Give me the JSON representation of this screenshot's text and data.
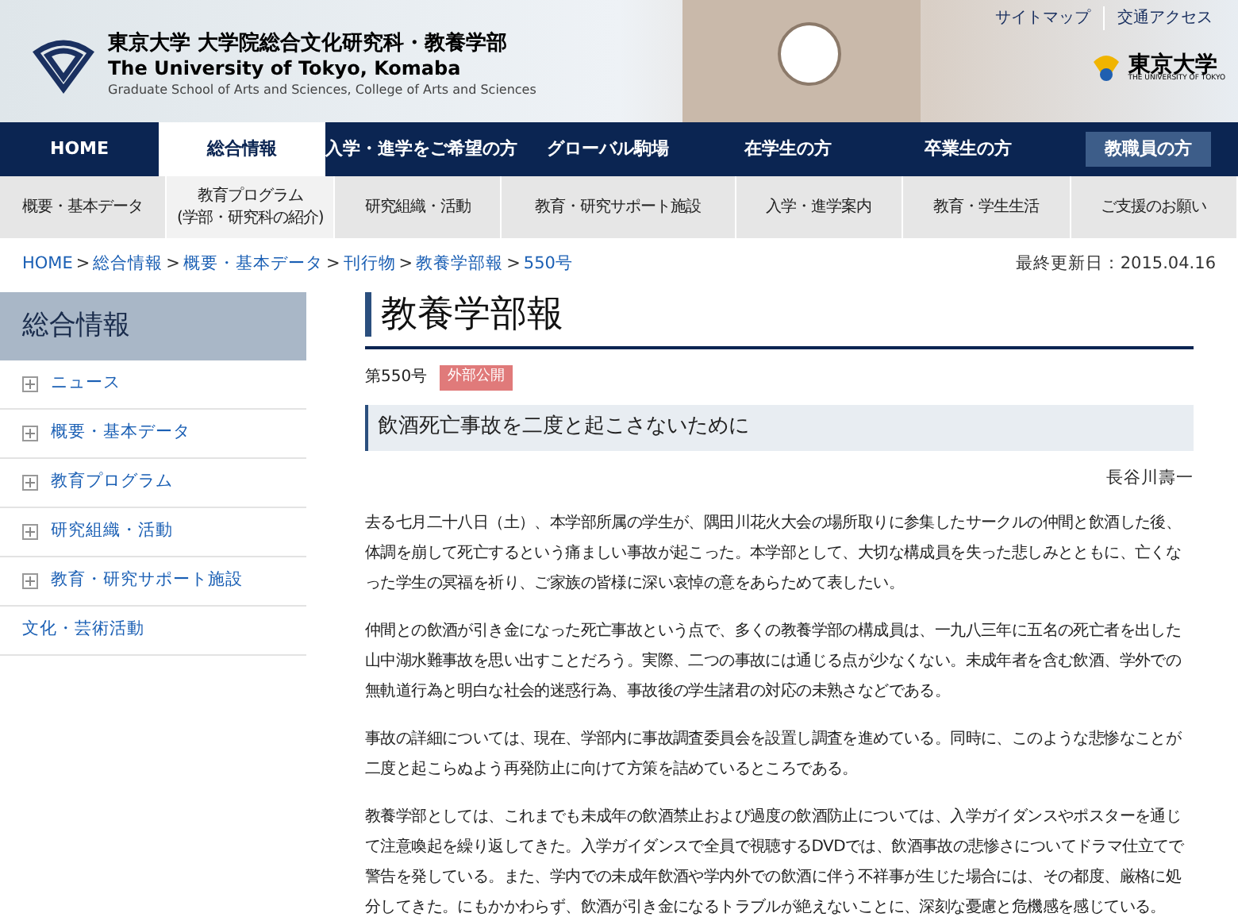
{
  "header": {
    "title_ja": "東京大学 大学院総合文化研究科・教養学部",
    "title_en": "The University of Tokyo, Komaba",
    "subtitle": "Graduate School of Arts and Sciences, College of Arts and Sciences",
    "utility_links": [
      "サイトマップ",
      "交通アクセス"
    ],
    "university_logo": {
      "name": "東京大学",
      "name_en": "THE UNIVERSITY OF TOKYO"
    }
  },
  "main_nav": [
    {
      "label": "HOME",
      "selected": false,
      "boxed": false
    },
    {
      "label": "総合情報",
      "selected": true,
      "boxed": false
    },
    {
      "label": "入学・進学をご希望の方",
      "selected": false,
      "boxed": false
    },
    {
      "label": "グローバル駒場",
      "selected": false,
      "boxed": false
    },
    {
      "label": "在学生の方",
      "selected": false,
      "boxed": false
    },
    {
      "label": "卒業生の方",
      "selected": false,
      "boxed": false
    },
    {
      "label": "教職員の方",
      "selected": false,
      "boxed": true
    }
  ],
  "sub_nav": [
    {
      "label": "概要・基本データ",
      "selected": false
    },
    {
      "label": "教育プログラム\n(学部・研究科の紹介)",
      "selected": true
    },
    {
      "label": "研究組織・活動",
      "selected": false
    },
    {
      "label": "教育・研究サポート施設",
      "selected": false
    },
    {
      "label": "入学・進学案内",
      "selected": false
    },
    {
      "label": "教育・学生生活",
      "selected": false
    },
    {
      "label": "ご支援のお願い",
      "selected": false
    }
  ],
  "breadcrumb_separator": ">",
  "breadcrumb": [
    "HOME",
    "総合情報",
    "概要・基本データ",
    "刊行物",
    "教養学部報",
    "550号"
  ],
  "last_updated": "最終更新日：2015.04.16",
  "sidebar": {
    "title": "総合情報",
    "items": [
      {
        "label": "ニュース",
        "kind": "expandable"
      },
      {
        "label": "概要・基本データ",
        "kind": "expandable"
      },
      {
        "label": "教育プログラム",
        "kind": "expandable"
      },
      {
        "label": "研究組織・活動",
        "kind": "expandable"
      },
      {
        "label": "教育・研究サポート施設",
        "kind": "expandable"
      },
      {
        "label": "文化・芸術活動",
        "kind": "plain"
      }
    ]
  },
  "article": {
    "page_title": "教養学部報",
    "issue": "第550号",
    "badge": "外部公開",
    "headline": "飲酒死亡事故を二度と起こさないために",
    "author": "長谷川壽一",
    "paragraphs": [
      "去る七月二十八日（土）、本学部所属の学生が、隅田川花火大会の場所取りに参集したサークルの仲間と飲酒した後、体調を崩して死亡するという痛ましい事故が起こった。本学部として、大切な構成員を失った悲しみとともに、亡くなった学生の冥福を祈り、ご家族の皆様に深い哀悼の意をあらためて表したい。",
      "仲間との飲酒が引き金になった死亡事故という点で、多くの教養学部の構成員は、一九八三年に五名の死亡者を出した山中湖水難事故を思い出すことだろう。実際、二つの事故には通じる点が少なくない。未成年者を含む飲酒、学外での無軌道行為と明白な社会的迷惑行為、事故後の学生諸君の対応の未熟さなどである。",
      "事故の詳細については、現在、学部内に事故調査委員会を設置し調査を進めている。同時に、このような悲惨なことが二度と起こらぬよう再発防止に向けて方策を詰めているところである。",
      "教養学部としては、これまでも未成年の飲酒禁止および過度の飲酒防止については、入学ガイダンスやポスターを通じて注意喚起を繰り返してきた。入学ガイダンスで全員で視聴するDVDでは、飲酒事故の悲惨さについてドラマ仕立てで警告を発している。また、学内での未成年飲酒や学内外での飲酒に伴う不祥事が生じた場合には、その都度、厳格に処分してきた。にもかかわらず、飲酒が引き金になるトラブルが絶えないことに、深刻な憂慮と危機感を感じている。"
    ]
  }
}
